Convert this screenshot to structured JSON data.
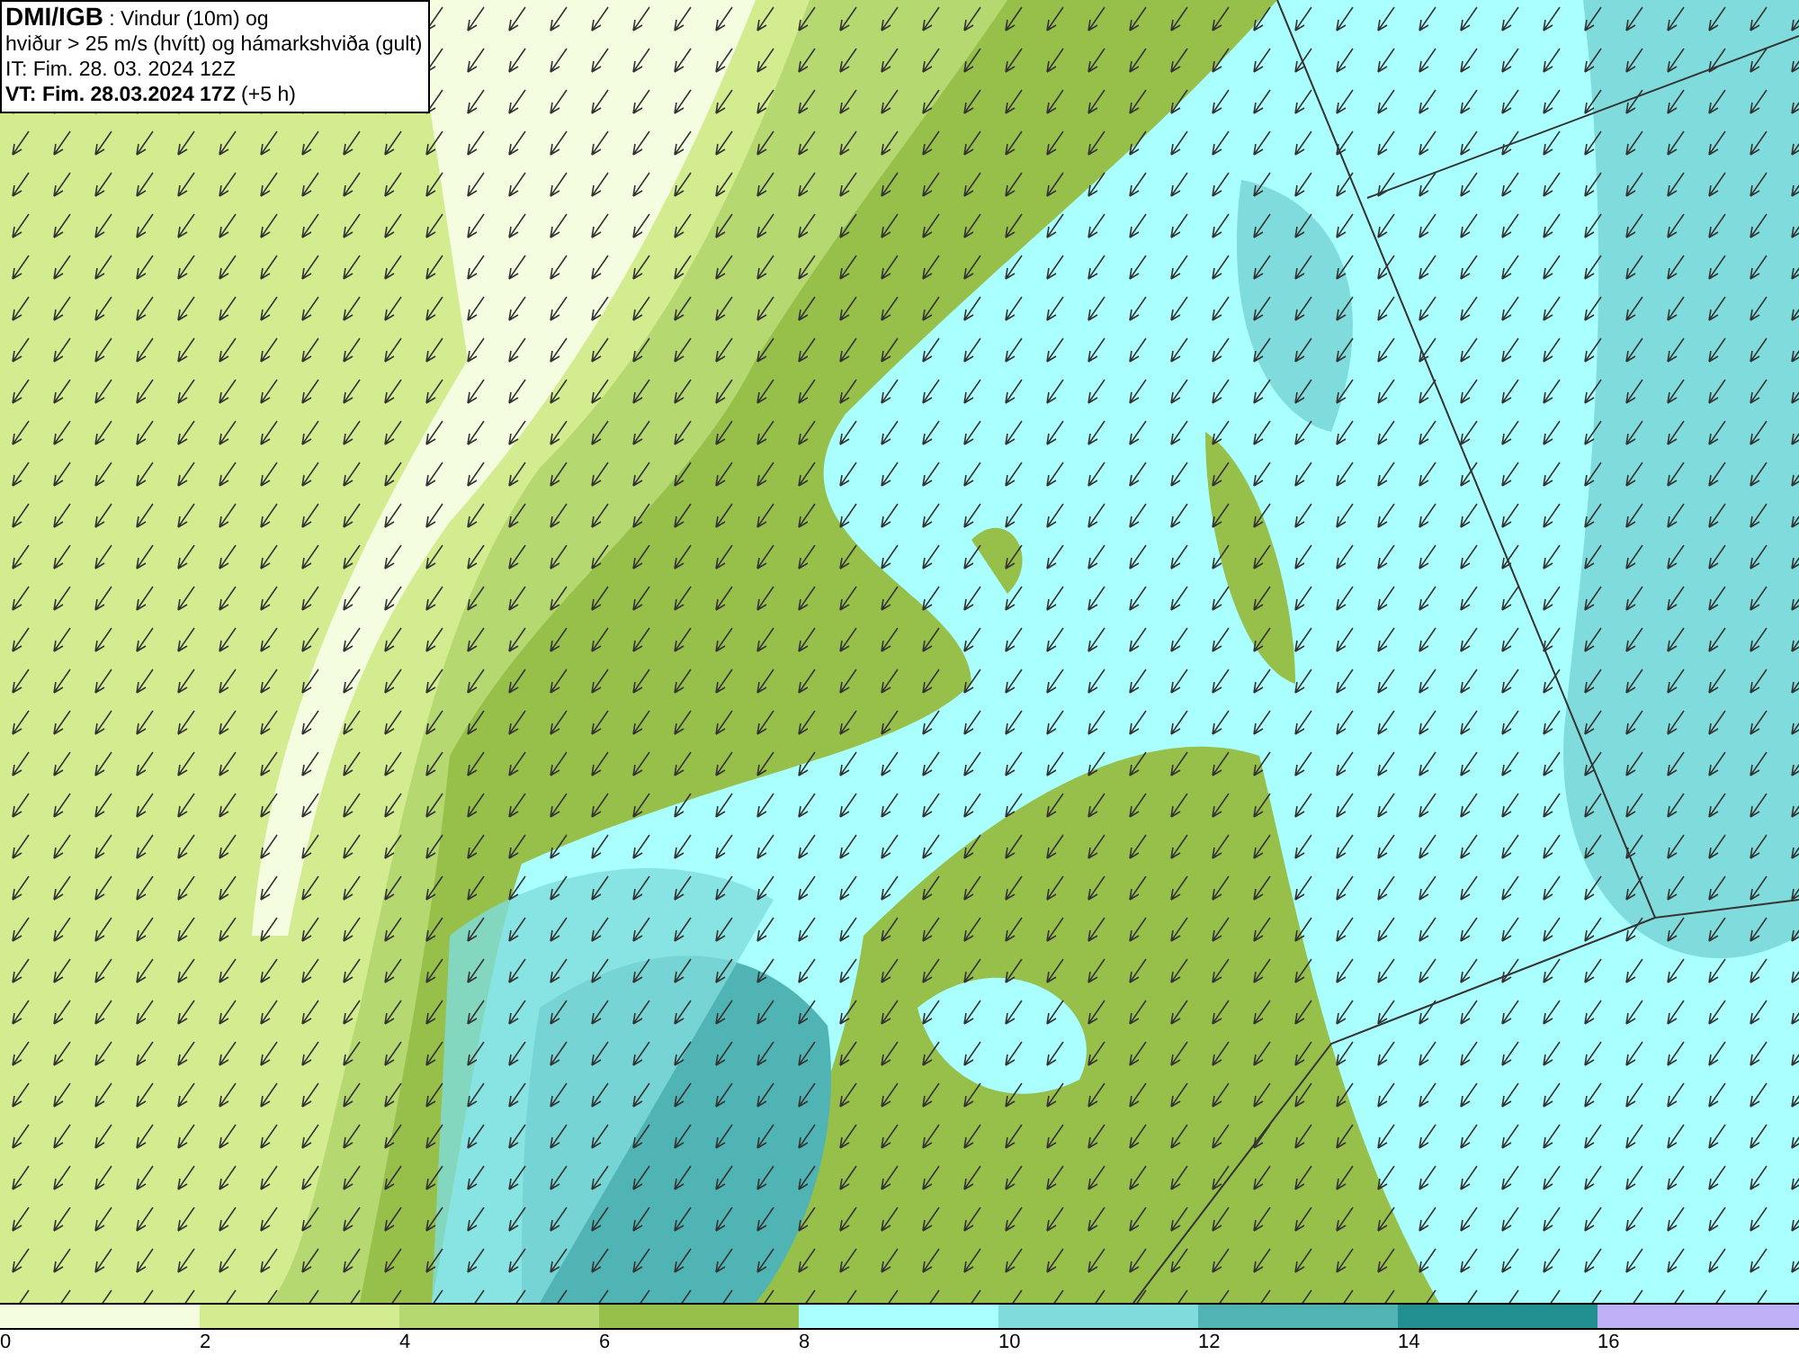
{
  "header": {
    "lines": [
      "**DMI/IGB** : Vindur (10m) og",
      "hviður > 25 m/s (hvítt) og hámarkshviða (gult)",
      "IT: Fim. 28. 03. 2024 12Z",
      "**VT: Fim. 28.03.2024 17Z** (+5 h)"
    ]
  },
  "legend": {
    "bins": [
      {
        "color": "#f5fde0",
        "label": "0"
      },
      {
        "color": "#d4ec90",
        "label": "2"
      },
      {
        "color": "#b6d870",
        "label": "4"
      },
      {
        "color": "#97c04a",
        "label": "6"
      },
      {
        "color": "#aaffff",
        "label": "8"
      },
      {
        "color": "#80dcdc",
        "label": "10"
      },
      {
        "color": "#50b4b4",
        "label": "12"
      },
      {
        "color": "#229090",
        "label": "14"
      },
      {
        "color": "#c0b0f8",
        "label": "16"
      }
    ]
  }
}
